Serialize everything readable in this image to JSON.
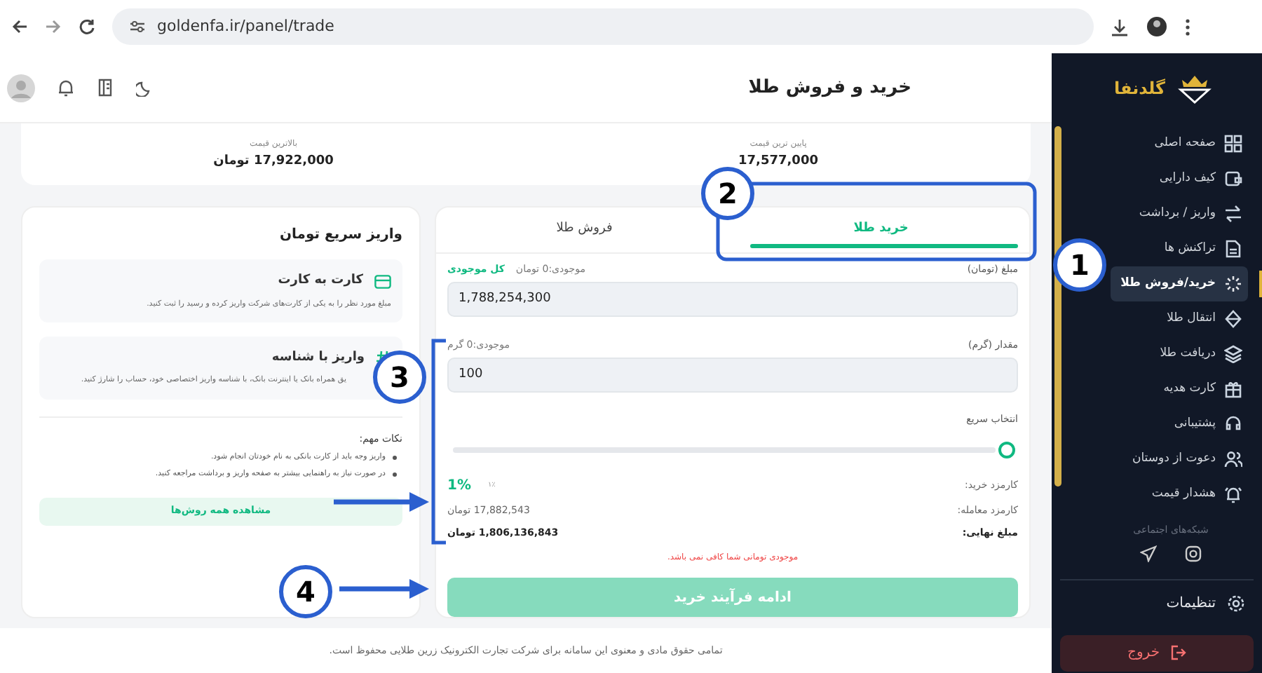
{
  "browser": {
    "url": "goldenfa.ir/panel/trade"
  },
  "header": {
    "title": "خرید و فروش طلا"
  },
  "sidebar": {
    "brand": "گلدنفا",
    "items": [
      {
        "label": "صفحه اصلی",
        "selected": false
      },
      {
        "label": "کیف دارایی",
        "selected": false
      },
      {
        "label": "واریز / برداشت",
        "selected": false
      },
      {
        "label": "تراکنش ها",
        "selected": false
      },
      {
        "label": "خرید/فروش طلا",
        "selected": true
      },
      {
        "label": "انتقال طلا",
        "selected": false
      },
      {
        "label": "دریافت طلا",
        "selected": false
      },
      {
        "label": "کارت هدیه",
        "selected": false
      },
      {
        "label": "پشتیبانی",
        "selected": false
      },
      {
        "label": "دعوت از دوستان",
        "selected": false
      },
      {
        "label": "هشدار قیمت",
        "selected": false
      }
    ],
    "social_title": "شبکه‌های اجتماعی",
    "settings": "تنظیمات",
    "logout": "خروج"
  },
  "prices": [
    {
      "label": "پایین ترین قیمت",
      "value": "17,577,000"
    },
    {
      "label": "بالاترین قیمت",
      "value": "17,922,000 تومان"
    }
  ],
  "trade": {
    "tabs": [
      {
        "label": "خرید طلا",
        "selected": true
      },
      {
        "label": "فروش طلا",
        "selected": false
      }
    ],
    "amount": {
      "label": "مبلغ (تومان)",
      "balance": "موجودی:0 تومان",
      "max_link": "کل موجودی",
      "value": "1,788,254,300"
    },
    "weight": {
      "label": "مقدار (گرم)",
      "balance": "موجودی:0 گرم",
      "value": "100"
    },
    "quick_select": {
      "label": "انتخاب سریع"
    },
    "fee": {
      "label": "کارمزد خرید:",
      "hint": "۱٪",
      "value": "1%"
    },
    "commission": {
      "label": "کارمزد معامله:",
      "value": "17,882,543 تومان"
    },
    "total": {
      "label": "مبلغ نهایی:",
      "value": "1,806,136,843 تومان"
    },
    "error": "موجودی تومانی شما کافی نمی باشد.",
    "submit": {
      "label": "ادامه فرآیند خرید",
      "disabled": true
    }
  },
  "deposit": {
    "title": "واریز سریع تومان",
    "methods": [
      {
        "kind": "card",
        "title": "کارت به کارت",
        "text": "مبلغ مورد نظر را به یکی از کارت‌های شرکت واریز کرده و رسید را ثبت کنید."
      },
      {
        "kind": "id",
        "title": "واریز با شناسه",
        "text": "یق همراه بانک یا اینترنت بانک، با شناسه واریز اختصاصی خود، حساب را شارژ کنید."
      }
    ],
    "notes_title": "نکات مهم:",
    "notes": [
      "واریز وجه باید از کارت بانکی به نام خودتان انجام شود.",
      "در صورت نیاز به راهنمایی بیشتر به صفحه واریز و برداشت مراجعه کنید."
    ],
    "all_methods": "مشاهده همه روش‌ها"
  },
  "footer": "تمامی حقوق مادی و معنوی این سامانه برای شرکت تجارت الکترونیک زرین طلایی محفوظ است.",
  "annotations": [
    {
      "label": "1"
    },
    {
      "label": "2"
    },
    {
      "label": "3"
    },
    {
      "label": "4"
    }
  ]
}
